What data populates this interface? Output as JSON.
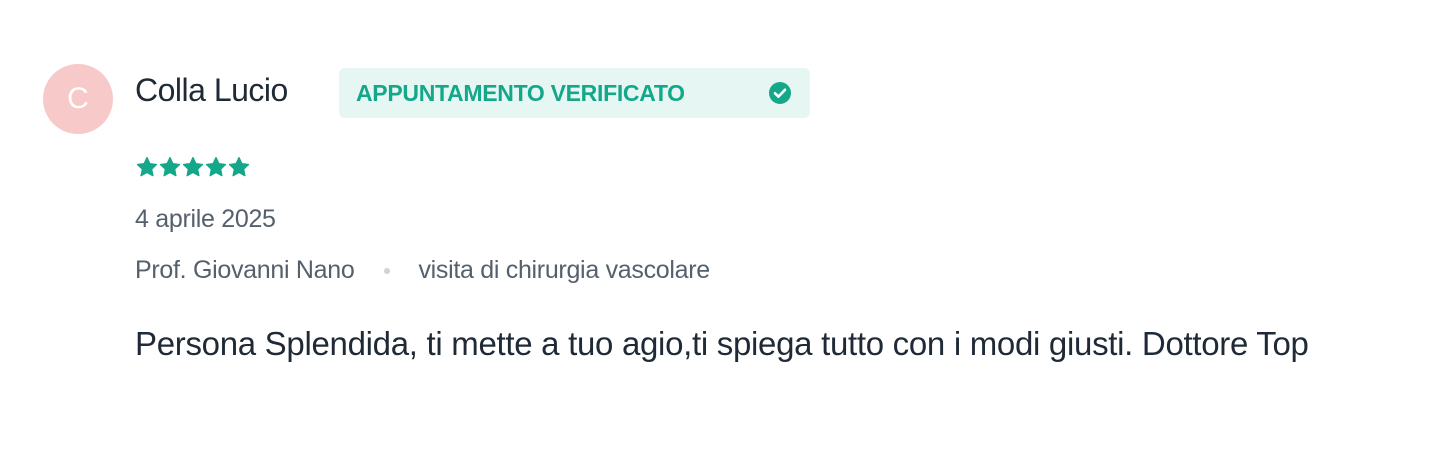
{
  "review": {
    "avatar_initial": "C",
    "author_name": "Colla Lucio",
    "badge_label": "APPUNTAMENTO VERIFICATO",
    "badge_icon": "check-circle-icon",
    "rating": 5,
    "rating_max": 5,
    "date": "4 aprile 2025",
    "doctor": "Prof. Giovanni Nano",
    "visit_type": "visita di chirurgia vascolare",
    "comment": "Persona Splendida, ti mette a tuo agio,ti spiega tutto con i modi giusti. Dottore Top"
  },
  "colors": {
    "avatar_bg": "#f7c9c8",
    "accent_green": "#14a789",
    "badge_bg": "#e6f7f3",
    "text_primary": "#1f2a36",
    "text_secondary": "#56606d"
  }
}
